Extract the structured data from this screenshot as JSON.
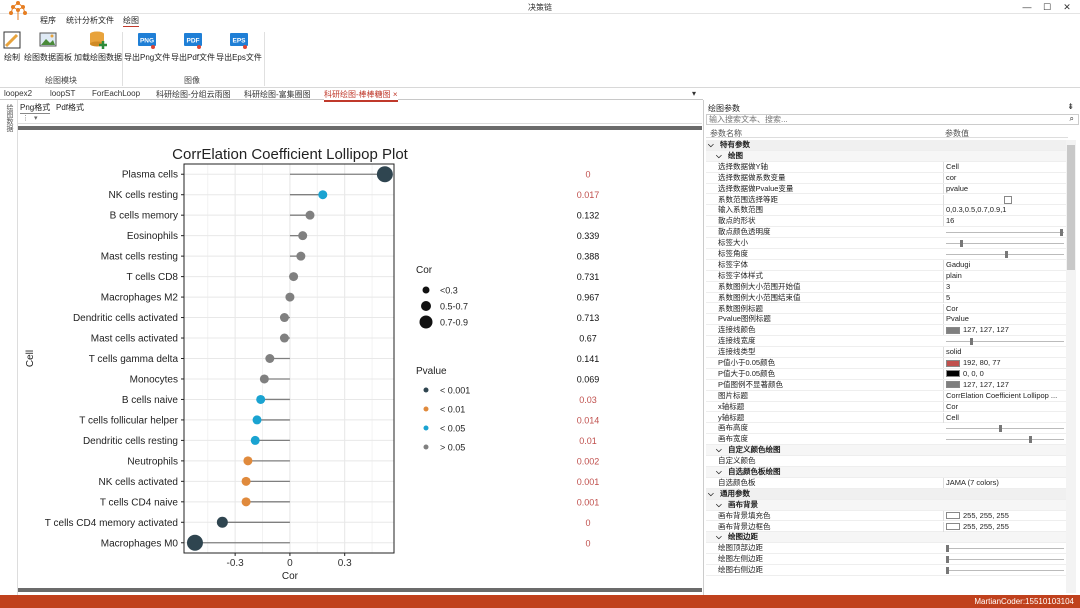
{
  "app": {
    "title": "决策链"
  },
  "ribbon": {
    "tabs": [
      "程序",
      "统计分析文件",
      "绘图"
    ],
    "active_tab": "绘图",
    "buttons": [
      {
        "label": "绘制",
        "icon": "pencil-icon"
      },
      {
        "label": "绘图数据面板",
        "icon": "image-panel-icon"
      },
      {
        "label": "加载绘图数据",
        "icon": "database-add-icon"
      },
      {
        "label": "导出Png文件",
        "icon": "png-file-icon"
      },
      {
        "label": "导出Pdf文件",
        "icon": "pdf-file-icon"
      },
      {
        "label": "导出Eps文件",
        "icon": "eps-file-icon"
      }
    ],
    "groups": [
      "绘图模块",
      "图像"
    ]
  },
  "doc_tabs": [
    "loopex2",
    "loopST",
    "ForEachLoop",
    "科研绘图-分组云雨图",
    "科研绘图-富集圈图",
    "科研绘图-棒棒糖图"
  ],
  "active_doc_tab": "科研绘图-棒棒糖图",
  "sidebar_label": "绘图数据",
  "sub_tabs": [
    "Png格式",
    "Pdf格式"
  ],
  "chart_data": {
    "type": "scatter",
    "title": "CorrElation Coefficient Lollipop Plot",
    "xlabel": "Cor",
    "ylabel": "Cell",
    "xlim": [
      -0.58,
      0.57
    ],
    "xticks": [
      -0.3,
      0.0,
      0.3
    ],
    "grid": true,
    "categories": [
      "Plasma cells",
      "NK cells resting",
      "B cells memory",
      "Eosinophils",
      "Mast cells resting",
      "T cells CD8",
      "Macrophages M2",
      "Dendritic cells activated",
      "Mast cells activated",
      "T cells gamma delta",
      "Monocytes",
      "B cells naive",
      "T cells follicular helper",
      "Dendritic cells resting",
      "Neutrophils",
      "NK cells activated",
      "T cells CD4 naive",
      "T cells CD4 memory activated",
      "Macrophages M0"
    ],
    "cor": [
      0.52,
      0.18,
      0.11,
      0.07,
      0.06,
      0.02,
      0.0,
      -0.03,
      -0.03,
      -0.11,
      -0.14,
      -0.16,
      -0.18,
      -0.19,
      -0.23,
      -0.24,
      -0.24,
      -0.37,
      -0.52
    ],
    "pvalue_labels": [
      "0",
      "0.017",
      "0.132",
      "0.339",
      "0.388",
      "0.731",
      "0.967",
      "0.713",
      "0.67",
      "0.141",
      "0.069",
      "0.03",
      "0.014",
      "0.01",
      "0.002",
      "0.001",
      "0.001",
      "0",
      "0"
    ],
    "pvalue_colors": [
      "#c0504d",
      "#c0504d",
      "#111111",
      "#111111",
      "#111111",
      "#111111",
      "#111111",
      "#111111",
      "#111111",
      "#111111",
      "#111111",
      "#c0504d",
      "#c0504d",
      "#c0504d",
      "#c0504d",
      "#c0504d",
      "#c0504d",
      "#c0504d",
      "#c0504d"
    ],
    "point_colors": [
      "#2f4550",
      "#1aa3d1",
      "#808080",
      "#808080",
      "#808080",
      "#808080",
      "#808080",
      "#808080",
      "#808080",
      "#808080",
      "#808080",
      "#1aa3d1",
      "#1aa3d1",
      "#1aa3d1",
      "#e08a3c",
      "#e08a3c",
      "#e08a3c",
      "#2f4550",
      "#2f4550"
    ],
    "size_legend": {
      "title": "Cor",
      "entries": [
        "<0.3",
        "0.5-0.7",
        "0.7-0.9"
      ]
    },
    "pvalue_legend": {
      "title": "Pvalue",
      "entries": [
        {
          "label": "< 0.001",
          "color": "#2f4550"
        },
        {
          "label": "< 0.01",
          "color": "#e08a3c"
        },
        {
          "label": "< 0.05",
          "color": "#1aa3d1"
        },
        {
          "label": "> 0.05",
          "color": "#808080"
        }
      ]
    }
  },
  "properties": {
    "title": "绘图参数",
    "search_placeholder": "输入搜索文本、搜索...",
    "col_name": "参数名称",
    "col_value": "参数值",
    "rows": [
      {
        "kind": "cat",
        "name": "特有参数"
      },
      {
        "kind": "sub",
        "name": "绘图"
      },
      {
        "name": "选择数据做Y轴",
        "value": "Cell"
      },
      {
        "name": "选择数据做系数变量",
        "value": "cor"
      },
      {
        "name": "选择数据做Pvalue变量",
        "value": "pvalue"
      },
      {
        "name": "系数范围选择等距",
        "value": "",
        "type": "check"
      },
      {
        "name": "输入系数范围",
        "value": "0,0.3,0.5,0.7,0.9,1"
      },
      {
        "name": "散点的形状",
        "value": "16"
      },
      {
        "name": "散点颜色透明度",
        "value": "",
        "type": "slider",
        "pos": 0.97
      },
      {
        "name": "标签大小",
        "value": "",
        "type": "slider",
        "pos": 0.12
      },
      {
        "name": "标签角度",
        "value": "",
        "type": "slider",
        "pos": 0.5
      },
      {
        "name": "标签字体",
        "value": "Gadugi"
      },
      {
        "name": "标签字体样式",
        "value": "plain"
      },
      {
        "name": "系数图例大小范围开始值",
        "value": "3"
      },
      {
        "name": "系数图例大小范围结束值",
        "value": "5"
      },
      {
        "name": "系数图例标题",
        "value": "Cor"
      },
      {
        "name": "Pvalue图例标题",
        "value": "Pvalue"
      },
      {
        "name": "连接线颜色",
        "value": "127, 127, 127",
        "swatch": "#7f7f7f"
      },
      {
        "name": "连接线宽度",
        "value": "",
        "type": "slider",
        "pos": 0.2
      },
      {
        "name": "连接线类型",
        "value": "solid"
      },
      {
        "name": "P值小于0.05颜色",
        "value": "192, 80, 77",
        "swatch": "#c0504d"
      },
      {
        "name": "P值大于0.05颜色",
        "value": "0, 0, 0",
        "swatch": "#000000"
      },
      {
        "name": "P值图例不显著颜色",
        "value": "127, 127, 127",
        "swatch": "#7f7f7f"
      },
      {
        "name": "图片标题",
        "value": "CorrElation Coefficient Lollipop ..."
      },
      {
        "name": "x轴标题",
        "value": "Cor"
      },
      {
        "name": "y轴标题",
        "value": "Cell"
      },
      {
        "name": "画布高度",
        "value": "",
        "type": "slider",
        "pos": 0.45
      },
      {
        "name": "画布宽度",
        "value": "",
        "type": "slider",
        "pos": 0.7
      },
      {
        "kind": "sub",
        "name": "自定义颜色绘图"
      },
      {
        "name": "自定义颜色",
        "value": ""
      },
      {
        "kind": "sub",
        "name": "自选颜色板绘图"
      },
      {
        "name": "自选颜色板",
        "value": "JAMA (7 colors)"
      },
      {
        "kind": "cat",
        "name": "通用参数"
      },
      {
        "kind": "sub",
        "name": "画布背景"
      },
      {
        "name": "画布背景填充色",
        "value": "255, 255, 255",
        "swatch": "#ffffff"
      },
      {
        "name": "画布背景边框色",
        "value": "255, 255, 255",
        "swatch": "#ffffff"
      },
      {
        "kind": "sub",
        "name": "绘图边距"
      },
      {
        "name": "绘图顶部边距",
        "value": "",
        "type": "slider",
        "pos": 0.0
      },
      {
        "name": "绘图左侧边距",
        "value": "",
        "type": "slider",
        "pos": 0.0
      },
      {
        "name": "绘图右侧边距",
        "value": "",
        "type": "slider",
        "pos": 0.0
      }
    ]
  },
  "status": "MartianCoder:15510103104"
}
